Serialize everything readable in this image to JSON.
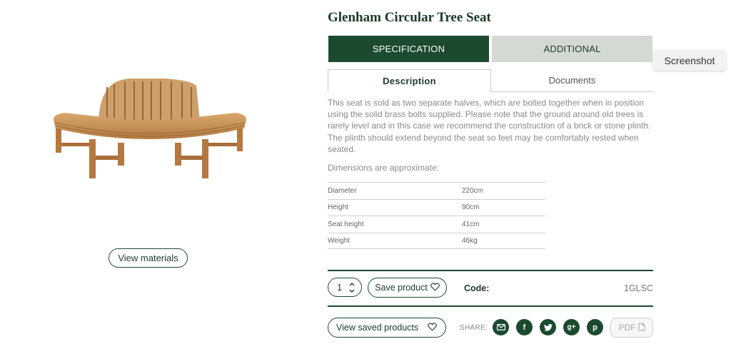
{
  "product": {
    "title": "Glenham Circular Tree Seat",
    "image_alt_icon": "circular-teak-bench",
    "view_materials_label": "View materials"
  },
  "tabs": {
    "main": [
      {
        "label": "SPECIFICATION",
        "active": true
      },
      {
        "label": "ADDITIONAL",
        "active": false
      }
    ],
    "sub": [
      {
        "label": "Description",
        "active": true
      },
      {
        "label": "Documents",
        "active": false
      }
    ]
  },
  "overlay": {
    "screenshot_label": "Screenshot"
  },
  "description": {
    "text": "This seat is sold as two separate halves, which are bolted together when in position using the solid brass bolts supplied. Please note that the ground around old trees is rarely level and in this case we recommend the construction of a brick or stone plinth. The plinth should extend beyond the seat so feet may be comfortably rested when seated.",
    "dimensions_label": "Dimensions are approximate:"
  },
  "specs": [
    {
      "name": "Diameter",
      "value": "220cm"
    },
    {
      "name": "Height",
      "value": "90cm"
    },
    {
      "name": "Seat height",
      "value": "41cm"
    },
    {
      "name": "Weight",
      "value": "46kg"
    }
  ],
  "purchase": {
    "quantity": "1",
    "save_label": "Save product",
    "code_label": "Code:",
    "code_value": "1GLSC"
  },
  "footer": {
    "view_saved_label": "View saved products",
    "share_label": "SHARE:",
    "social_icons": [
      "email-icon",
      "facebook-icon",
      "twitter-icon",
      "google-plus-icon",
      "pinterest-icon"
    ],
    "pdf_label": "PDF"
  },
  "colors": {
    "brand_green": "#1b4a2f",
    "tab_inactive": "#d4d9d4",
    "wood": "#c8955a"
  }
}
